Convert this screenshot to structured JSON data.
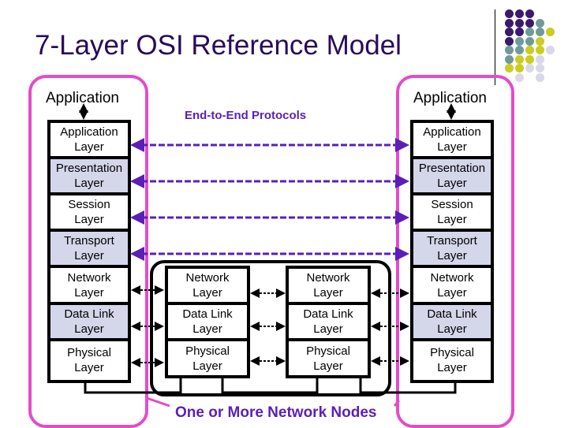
{
  "title": "7-Layer OSI Reference Model",
  "left_host": {
    "application_label": "Application",
    "layers": [
      {
        "line1": "Application",
        "line2": "Layer"
      },
      {
        "line1": "Presentation",
        "line2": "Layer"
      },
      {
        "line1": "Session",
        "line2": "Layer"
      },
      {
        "line1": "Transport",
        "line2": "Layer"
      },
      {
        "line1": "Network",
        "line2": "Layer"
      },
      {
        "line1": "Data Link",
        "line2": "Layer"
      },
      {
        "line1": "Physical",
        "line2": "Layer"
      }
    ]
  },
  "right_host": {
    "application_label": "Application",
    "layers": [
      {
        "line1": "Application",
        "line2": "Layer"
      },
      {
        "line1": "Presentation",
        "line2": "Layer"
      },
      {
        "line1": "Session",
        "line2": "Layer"
      },
      {
        "line1": "Transport",
        "line2": "Layer"
      },
      {
        "line1": "Network",
        "line2": "Layer"
      },
      {
        "line1": "Data Link",
        "line2": "Layer"
      },
      {
        "line1": "Physical",
        "line2": "Layer"
      }
    ]
  },
  "node1": {
    "layers": [
      {
        "line1": "Network",
        "line2": "Layer"
      },
      {
        "line1": "Data Link",
        "line2": "Layer"
      },
      {
        "line1": "Physical",
        "line2": "Layer"
      }
    ]
  },
  "node2": {
    "layers": [
      {
        "line1": "Network",
        "line2": "Layer"
      },
      {
        "line1": "Data Link",
        "line2": "Layer"
      },
      {
        "line1": "Physical",
        "line2": "Layer"
      }
    ]
  },
  "labels": {
    "end_to_end": "End-to-End Protocols",
    "network_nodes": "One or More Network Nodes"
  },
  "colors": {
    "title": "#2a0a5a",
    "host_outline": "#e44cc8",
    "protocol_arrow": "#5b1fb8",
    "shaded_layer": "#d4d6ea",
    "dot_palette": [
      "#3a1a6a",
      "#6e9a9a",
      "#cccc22",
      "#d8d8e8"
    ]
  }
}
